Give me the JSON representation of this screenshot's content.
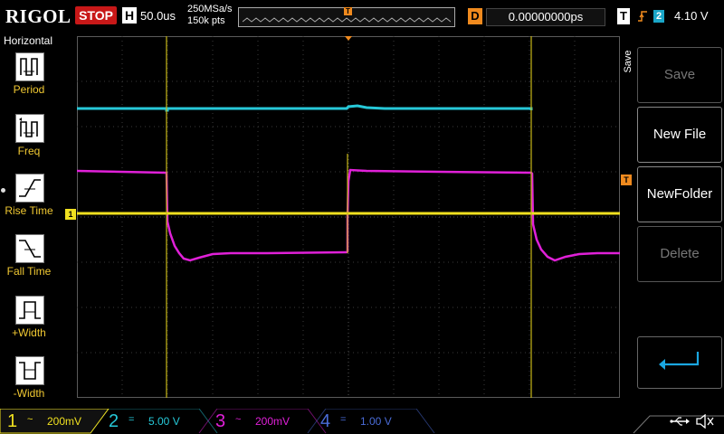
{
  "topbar": {
    "brand": "RIGOL",
    "run_status": "STOP",
    "timebase_badge": "H",
    "timebase": "50.0us",
    "sample_rate": "250MSa/s",
    "mem_depth": "150k pts",
    "delay_badge": "D",
    "delay": "0.00000000ps",
    "trigger_badge": "T",
    "trigger_source": "2",
    "trigger_level": "4.10 V",
    "mem_trigger_marker": "T",
    "trigger_edge_icon": "rising-edge-icon"
  },
  "left_menu": {
    "title": "Horizontal",
    "items": [
      {
        "label": "Period",
        "icon": "period-icon"
      },
      {
        "label": "Freq",
        "icon": "frequency-icon"
      },
      {
        "label": "Rise Time",
        "icon": "rise-time-icon"
      },
      {
        "label": "Fall Time",
        "icon": "fall-time-icon"
      },
      {
        "label": "+Width",
        "icon": "positive-width-icon"
      },
      {
        "label": "-Width",
        "icon": "negative-width-icon"
      }
    ]
  },
  "right_menu": {
    "tab_label": "Save",
    "keys": [
      {
        "label": "Save",
        "enabled": false
      },
      {
        "label": "New File",
        "enabled": true
      },
      {
        "label": "NewFolder",
        "enabled": true
      },
      {
        "label": "Delete",
        "enabled": false
      }
    ],
    "return_icon": "return-arrow-icon"
  },
  "screen": {
    "ch1_marker": "1",
    "trigger_level_marker": "T"
  },
  "channels": [
    {
      "num": "1",
      "coupling": "~",
      "scale": "200mV",
      "color": "#f0e020",
      "active": true
    },
    {
      "num": "2",
      "coupling": "=",
      "scale": "5.00 V",
      "color": "#26c8d8",
      "active": false
    },
    {
      "num": "3",
      "coupling": "~",
      "scale": "200mV",
      "color": "#e020d8",
      "active": false
    },
    {
      "num": "4",
      "coupling": "=",
      "scale": "1.00 V",
      "color": "#4a6cd8",
      "active": false
    }
  ],
  "status_icons": {
    "usb": "usb-icon",
    "mute": "speaker-mute-icon"
  },
  "colors": {
    "ch1": "#f0e020",
    "ch2": "#26c8d8",
    "ch3": "#e020d8",
    "ch4": "#4a6cd8",
    "trigger": "#f08a1e",
    "stop": "#c81818",
    "menu_label": "#f0c832"
  }
}
